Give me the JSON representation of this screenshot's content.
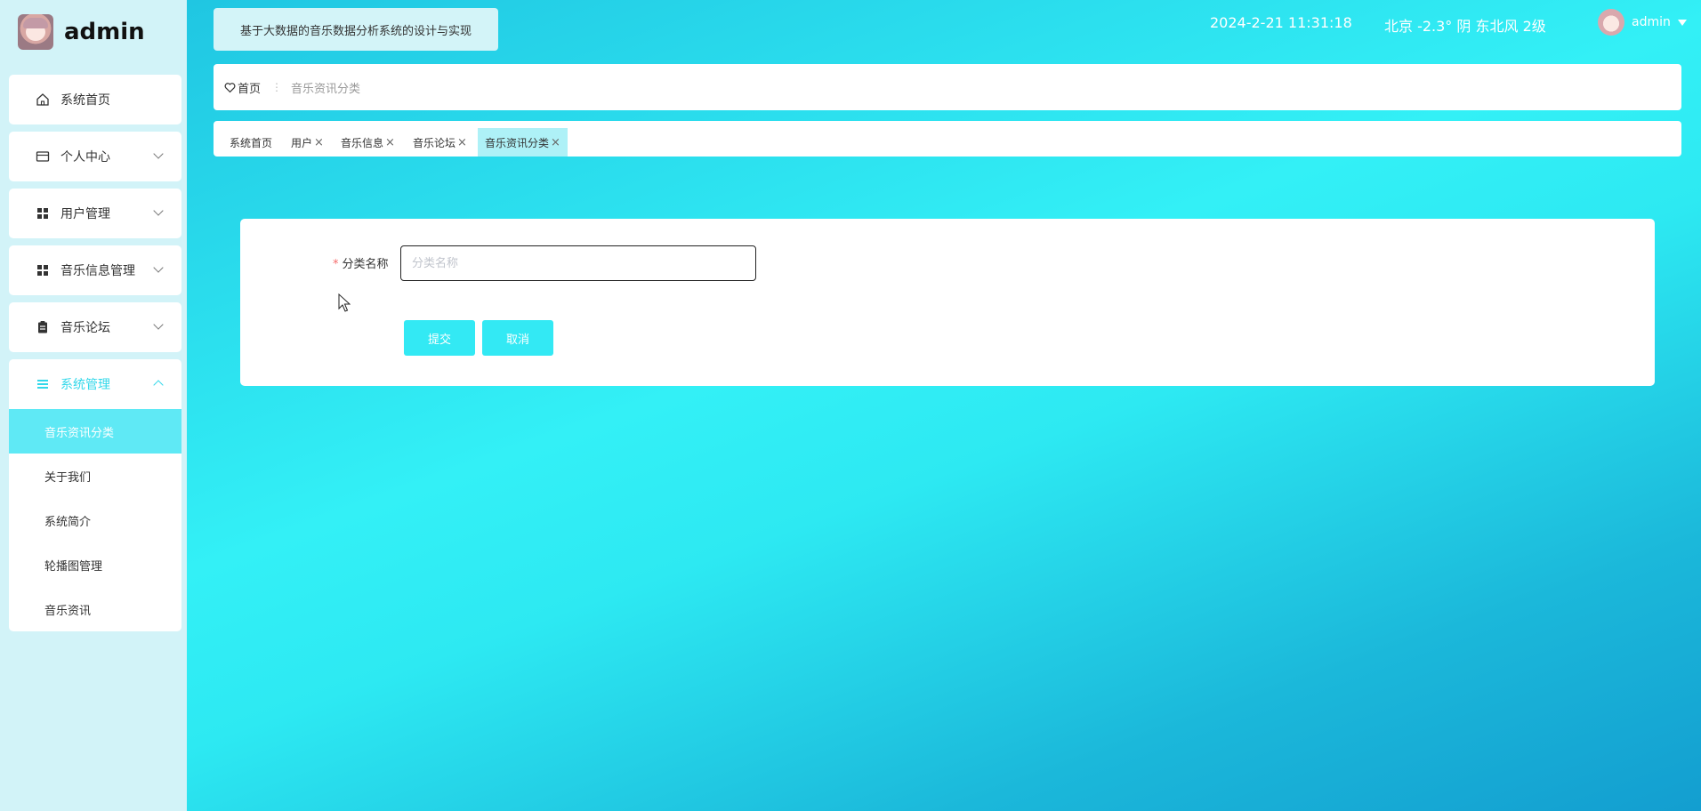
{
  "brand": {
    "name": "admin"
  },
  "sidebar": {
    "items": [
      {
        "label": "系统首页",
        "icon": "home-icon"
      },
      {
        "label": "个人中心",
        "icon": "card-icon"
      },
      {
        "label": "用户管理",
        "icon": "grid-icon"
      },
      {
        "label": "音乐信息管理",
        "icon": "grid-icon"
      },
      {
        "label": "音乐论坛",
        "icon": "clipboard-icon"
      }
    ],
    "expanded": {
      "label": "系统管理",
      "icon": "list-icon",
      "children": [
        "音乐资讯分类",
        "关于我们",
        "系统简介",
        "轮播图管理",
        "音乐资讯"
      ],
      "active_child": "音乐资讯分类"
    }
  },
  "header": {
    "title": "基于大数据的音乐数据分析系统的设计与实现",
    "datetime": "2024-2-21 11:31:18",
    "weather": "北京  -2.3°  阴  东北风  2级",
    "user": "admin"
  },
  "breadcrumb": {
    "home": "首页",
    "separator": "⋮",
    "current": "音乐资讯分类"
  },
  "tags": [
    {
      "label": "系统首页",
      "closable": false
    },
    {
      "label": "用户",
      "closable": true
    },
    {
      "label": "音乐信息",
      "closable": true
    },
    {
      "label": "音乐论坛",
      "closable": true
    },
    {
      "label": "音乐资讯分类",
      "closable": true,
      "active": true
    }
  ],
  "form": {
    "required_mark": "*",
    "label": "分类名称",
    "placeholder": "分类名称",
    "value": "",
    "submit": "提交",
    "cancel": "取消"
  },
  "colors": {
    "accent": "#33e9f4",
    "sidebar_bg": "#d2f3f8",
    "active_item": "#5fe9f5",
    "required": "#f56c6c"
  }
}
